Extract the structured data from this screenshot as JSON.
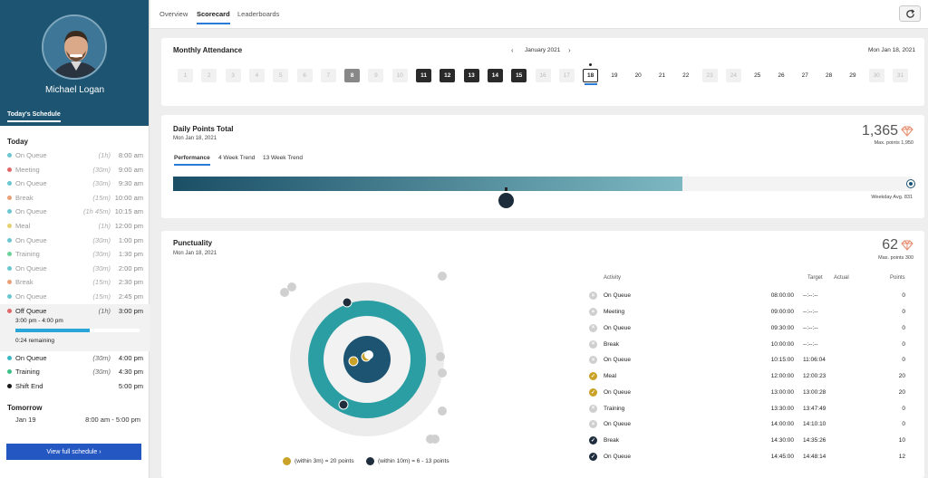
{
  "sidebar": {
    "user_name": "Michael Logan",
    "tab": "Today's Schedule",
    "today_label": "Today",
    "today": [
      {
        "activity": "On Queue",
        "duration": "(1h)",
        "time": "8:00 am",
        "color": "#6cc6d0"
      },
      {
        "activity": "Meeting",
        "duration": "(30m)",
        "time": "9:00 am",
        "color": "#e0686a"
      },
      {
        "activity": "On Queue",
        "duration": "(30m)",
        "time": "9:30 am",
        "color": "#6cc6d0"
      },
      {
        "activity": "Break",
        "duration": "(15m)",
        "time": "10:00 am",
        "color": "#e8a078"
      },
      {
        "activity": "On Queue",
        "duration": "(1h 45m)",
        "time": "10:15 am",
        "color": "#6cc6d0"
      },
      {
        "activity": "Meal",
        "duration": "(1h)",
        "time": "12:00 pm",
        "color": "#e6d070"
      },
      {
        "activity": "On Queue",
        "duration": "(30m)",
        "time": "1:00 pm",
        "color": "#6cc6d0"
      },
      {
        "activity": "Training",
        "duration": "(30m)",
        "time": "1:30 pm",
        "color": "#6cd09a"
      },
      {
        "activity": "On Queue",
        "duration": "(30m)",
        "time": "2:00 pm",
        "color": "#6cc6d0"
      },
      {
        "activity": "Break",
        "duration": "(15m)",
        "time": "2:30 pm",
        "color": "#e8a078"
      },
      {
        "activity": "On Queue",
        "duration": "(15m)",
        "time": "2:45 pm",
        "color": "#6cc6d0"
      }
    ],
    "current": {
      "activity": "Off Queue",
      "duration": "(1h)",
      "time": "3:00 pm",
      "color": "#e0686a",
      "range": "3:00 pm - 4:00 pm",
      "remaining": "0:24 remaining",
      "progress": 0.6
    },
    "upcoming": [
      {
        "activity": "On Queue",
        "duration": "(30m)",
        "time": "4:00 pm",
        "color": "#3cb8c4"
      },
      {
        "activity": "Training",
        "duration": "(30m)",
        "time": "4:30 pm",
        "color": "#3cc088"
      },
      {
        "activity": "Shift End",
        "duration": "",
        "time": "5:00 pm",
        "color": "#1a1a1a"
      }
    ],
    "tomorrow_label": "Tomorrow",
    "tomorrow_date": "Jan 19",
    "tomorrow_range": "8:00 am - 5:00 pm",
    "view_button": "View full schedule ›"
  },
  "nav": {
    "tabs": [
      "Overview",
      "Scorecard",
      "Leaderboards"
    ],
    "active": "Scorecard",
    "refresh_icon": "refresh-icon"
  },
  "attendance": {
    "title": "Monthly Attendance",
    "month": "January 2021",
    "date": "Mon Jan 18, 2021",
    "days": [
      {
        "d": "1",
        "s": "faded"
      },
      {
        "d": "2",
        "s": "faded"
      },
      {
        "d": "3",
        "s": "faded"
      },
      {
        "d": "4",
        "s": "faded"
      },
      {
        "d": "5",
        "s": "faded"
      },
      {
        "d": "6",
        "s": "faded"
      },
      {
        "d": "7",
        "s": "faded"
      },
      {
        "d": "8",
        "s": "gray"
      },
      {
        "d": "9",
        "s": "faded"
      },
      {
        "d": "10",
        "s": "faded"
      },
      {
        "d": "11",
        "s": "dark"
      },
      {
        "d": "12",
        "s": "dark"
      },
      {
        "d": "13",
        "s": "dark"
      },
      {
        "d": "14",
        "s": "dark"
      },
      {
        "d": "15",
        "s": "dark"
      },
      {
        "d": "16",
        "s": "faded"
      },
      {
        "d": "17",
        "s": "faded"
      },
      {
        "d": "18",
        "s": "today"
      },
      {
        "d": "19",
        "s": "plain"
      },
      {
        "d": "20",
        "s": "plain"
      },
      {
        "d": "21",
        "s": "plain"
      },
      {
        "d": "22",
        "s": "plain"
      },
      {
        "d": "23",
        "s": "faded"
      },
      {
        "d": "24",
        "s": "faded"
      },
      {
        "d": "25",
        "s": "plain"
      },
      {
        "d": "26",
        "s": "plain"
      },
      {
        "d": "27",
        "s": "plain"
      },
      {
        "d": "28",
        "s": "plain"
      },
      {
        "d": "29",
        "s": "plain"
      },
      {
        "d": "30",
        "s": "faded"
      },
      {
        "d": "31",
        "s": "faded"
      }
    ]
  },
  "points": {
    "title": "Daily Points Total",
    "date": "Mon Jan 18, 2021",
    "tabs": [
      "Performance",
      "4 Week Trend",
      "13 Week Trend"
    ],
    "active_tab": "Performance",
    "value": "1,365",
    "max_label": "Max. points 1,950",
    "fill_fraction": 0.69,
    "weekday_avg": "Weekday Avg. 831"
  },
  "punctuality": {
    "title": "Punctuality",
    "date": "Mon Jan 18, 2021",
    "value": "62",
    "max_label": "Max. points 300",
    "headers": [
      "Activity",
      "Target",
      "Actual",
      "Points"
    ],
    "rows": [
      {
        "activity": "On Queue",
        "target": "08:00:00",
        "actual": "--:--:--",
        "points": "0",
        "status": "miss"
      },
      {
        "activity": "Meeting",
        "target": "09:00:00",
        "actual": "--:--:--",
        "points": "0",
        "status": "miss"
      },
      {
        "activity": "On Queue",
        "target": "09:30:00",
        "actual": "--:--:--",
        "points": "0",
        "status": "miss"
      },
      {
        "activity": "Break",
        "target": "10:00:00",
        "actual": "--:--:--",
        "points": "0",
        "status": "miss"
      },
      {
        "activity": "On Queue",
        "target": "10:15:00",
        "actual": "11:06:04",
        "points": "0",
        "status": "miss"
      },
      {
        "activity": "Meal",
        "target": "12:00:00",
        "actual": "12:00:23",
        "points": "20",
        "status": "gold"
      },
      {
        "activity": "On Queue",
        "target": "13:00:00",
        "actual": "13:00:28",
        "points": "20",
        "status": "gold"
      },
      {
        "activity": "Training",
        "target": "13:30:00",
        "actual": "13:47:49",
        "points": "0",
        "status": "miss"
      },
      {
        "activity": "On Queue",
        "target": "14:00:00",
        "actual": "14:10:10",
        "points": "0",
        "status": "miss"
      },
      {
        "activity": "Break",
        "target": "14:30:00",
        "actual": "14:35:26",
        "points": "10",
        "status": "blk"
      },
      {
        "activity": "On Queue",
        "target": "14:45:00",
        "actual": "14:48:14",
        "points": "12",
        "status": "blk"
      }
    ],
    "legend": [
      {
        "label": "(within 3m) = 20 points",
        "color": "#c9a227"
      },
      {
        "label": "(within 10m) = 6 - 13 points",
        "color": "#1f2d3d"
      }
    ]
  }
}
